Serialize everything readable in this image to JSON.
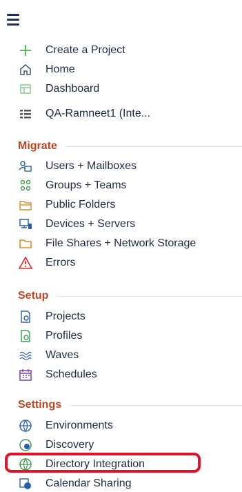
{
  "colors": {
    "section_heading": "#c2451e",
    "text": "#1f2a44",
    "highlight_border": "#e0132a",
    "create_icon": "#3cb54a"
  },
  "top_nav": {
    "create_project": "Create a Project",
    "home": "Home",
    "dashboard": "Dashboard",
    "project": "QA-Ramneet1 (Inte..."
  },
  "migrate": {
    "heading": "Migrate",
    "items": [
      "Users + Mailboxes",
      "Groups + Teams",
      "Public Folders",
      "Devices + Servers",
      "File Shares + Network Storage",
      "Errors"
    ]
  },
  "setup": {
    "heading": "Setup",
    "items": [
      "Projects",
      "Profiles",
      "Waves",
      "Schedules"
    ]
  },
  "settings": {
    "heading": "Settings",
    "items": [
      "Environments",
      "Discovery",
      "Directory Integration",
      "Calendar Sharing"
    ]
  }
}
